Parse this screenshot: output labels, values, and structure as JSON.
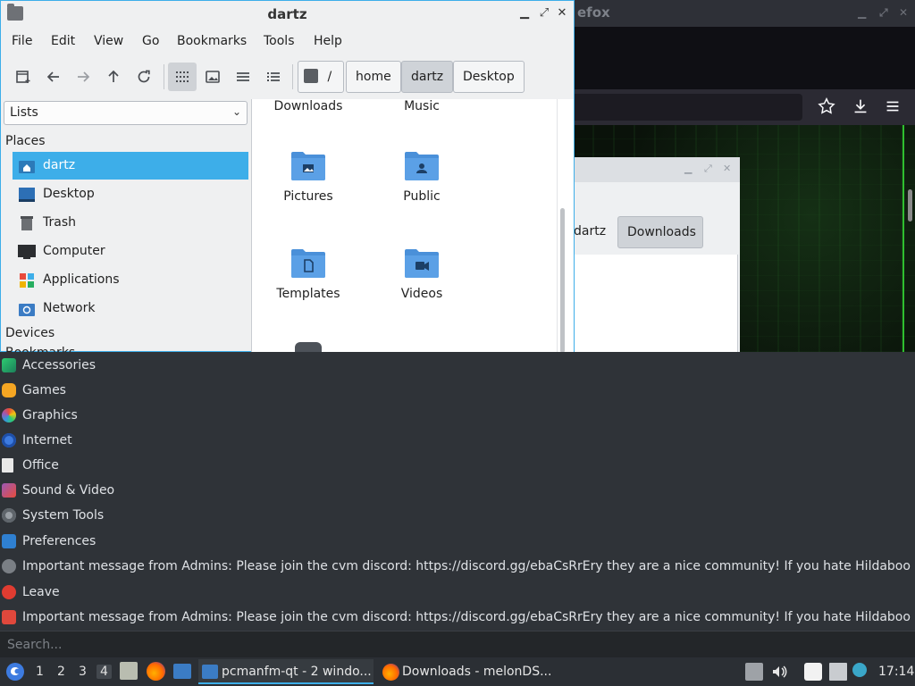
{
  "firefox": {
    "title": "efox"
  },
  "file_manager_back": {
    "crumb_partial": "dartz",
    "crumb_current": "Downloads"
  },
  "file_manager": {
    "title": "dartz",
    "menu": [
      "File",
      "Edit",
      "View",
      "Go",
      "Bookmarks",
      "Tools",
      "Help"
    ],
    "breadcrumb": [
      "/",
      "home",
      "dartz",
      "Desktop"
    ],
    "side_select": "Lists",
    "places_header": "Places",
    "places": [
      "dartz",
      "Desktop",
      "Trash",
      "Computer",
      "Applications",
      "Network"
    ],
    "devices_header": "Devices",
    "bookmarks_header": "Bookmarks",
    "folders": [
      "Downloads",
      "Music",
      "Pictures",
      "Public",
      "Templates",
      "Videos"
    ]
  },
  "launcher": {
    "items": [
      "Accessories",
      "Games",
      "Graphics",
      "Internet",
      "Office",
      "Sound & Video",
      "System Tools",
      "Preferences",
      "Important message from Admins: Please join the cvm discord: https://discord.gg/ebaCsRrEry they are a nice community! If you hate Hildaboo or any",
      "Leave",
      "Important message from Admins: Please join the cvm discord: https://discord.gg/ebaCsRrEry they are a nice community! If you hate Hildaboo or any"
    ],
    "search_placeholder": "Search..."
  },
  "taskbar": {
    "workspaces": [
      "1",
      "2",
      "3",
      "4"
    ],
    "tasks": [
      "pcmanfm-qt - 2 windo...",
      "Downloads - melonDS..."
    ],
    "clock": "17:14"
  },
  "colors": {
    "accent": "#3daee9",
    "folder_blue": "#4a90d9",
    "panel_dark": "#2f3338"
  }
}
